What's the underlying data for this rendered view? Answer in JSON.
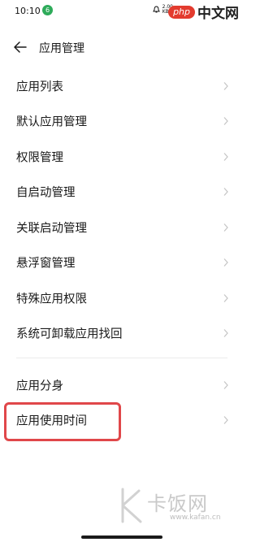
{
  "status_bar": {
    "time": "10:10",
    "app_badge": "6",
    "net_speed_value": "2.00",
    "net_speed_unit": "KB/s"
  },
  "watermark_top": {
    "brand": "php",
    "cn": "中文网"
  },
  "header": {
    "title": "应用管理"
  },
  "menu": {
    "items": [
      {
        "label": "应用列表"
      },
      {
        "label": "默认应用管理"
      },
      {
        "label": "权限管理"
      },
      {
        "label": "自启动管理"
      },
      {
        "label": "关联启动管理"
      },
      {
        "label": "悬浮窗管理"
      },
      {
        "label": "特殊应用权限"
      },
      {
        "label": "系统可卸载应用找回"
      }
    ]
  },
  "menu2": {
    "items": [
      {
        "label": "应用分身"
      },
      {
        "label": "应用使用时间"
      }
    ]
  },
  "watermark_bottom": {
    "name": "卡饭网",
    "url": "www.kafan.cn"
  },
  "colors": {
    "highlight": "#e0474a",
    "text": "#1a1a1a",
    "chevron": "#c4c4c4"
  }
}
